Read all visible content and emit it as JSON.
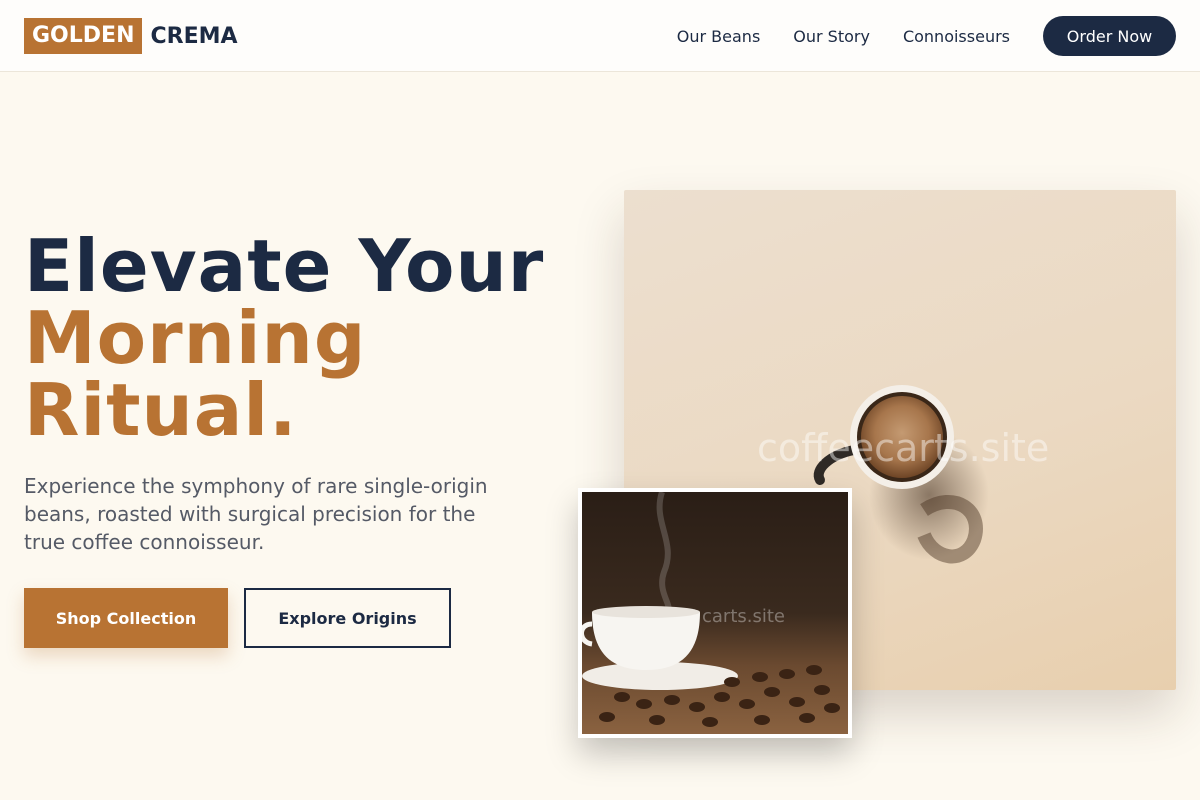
{
  "brand": {
    "logo_box": "GOLDEN",
    "logo_text": "CREMA",
    "accent_color": "#b87333",
    "navy_color": "#1c2a43"
  },
  "nav": {
    "links": [
      "Our Beans",
      "Our Story",
      "Connoisseurs"
    ],
    "cta": "Order Now"
  },
  "hero": {
    "title_line1": "Elevate Your",
    "title_line2": "Morning",
    "title_line3": "Ritual.",
    "subtitle": "Experience the symphony of rare single-origin beans, roasted with surgical precision for the true coffee connoisseur.",
    "primary_button": "Shop Collection",
    "secondary_button": "Explore Origins"
  },
  "images": {
    "main_watermark": "coffeecarts.site",
    "inset_watermark": "carts.site",
    "main_icon": "espresso-cup-photo",
    "inset_icon": "coffee-cup-beans-photo"
  }
}
